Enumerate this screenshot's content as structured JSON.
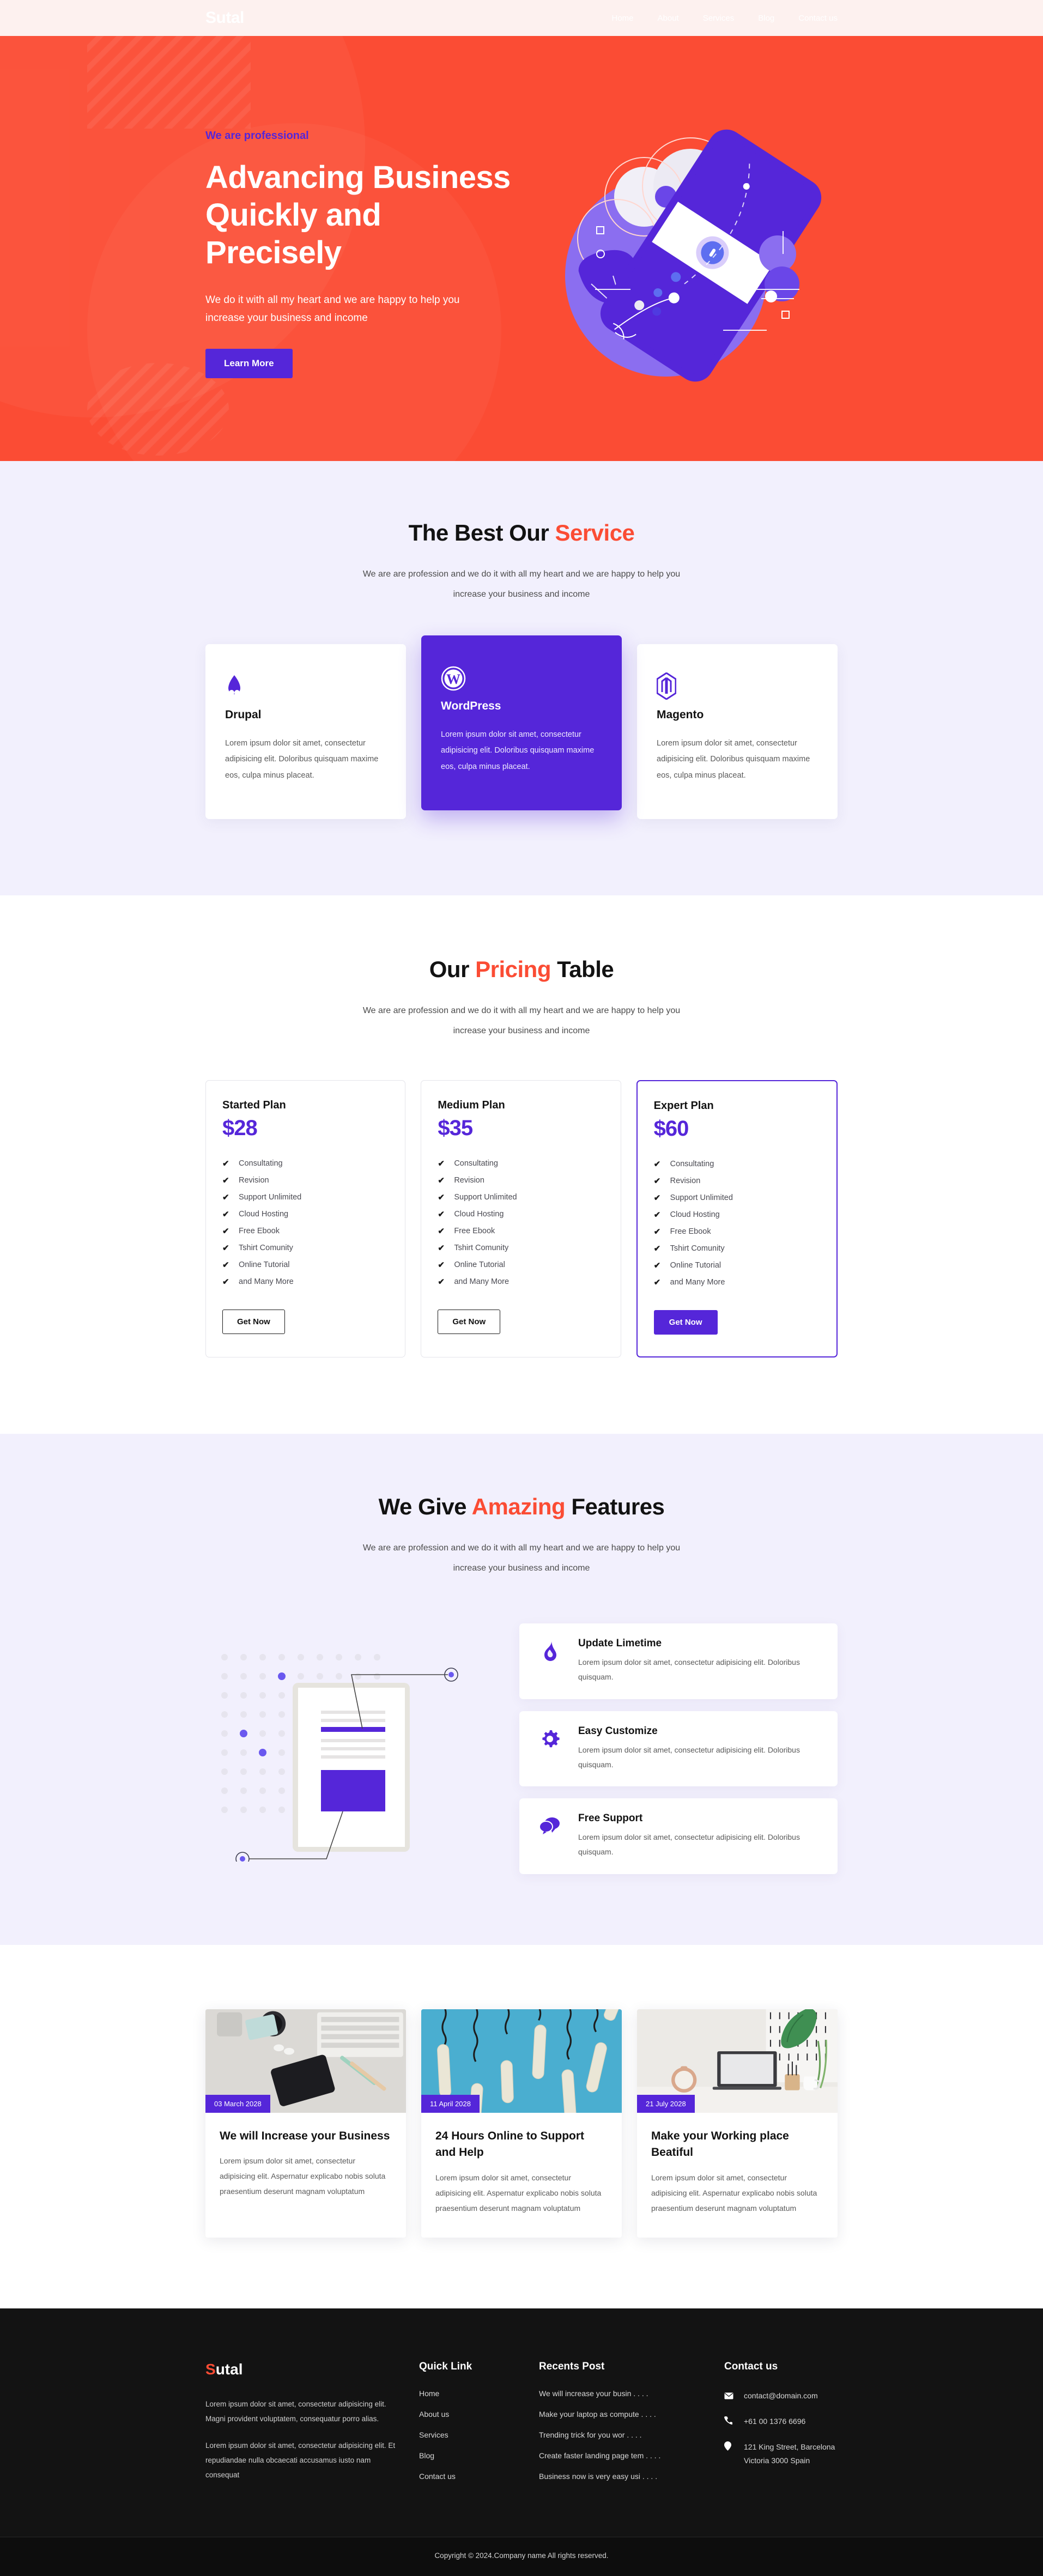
{
  "header": {
    "logo_s": "S",
    "logo_rest": "utal",
    "nav": [
      {
        "label": "Home"
      },
      {
        "label": "About"
      },
      {
        "label": "Services"
      },
      {
        "label": "Blog"
      },
      {
        "label": "Contact us"
      }
    ]
  },
  "hero": {
    "kicker": "We are professional",
    "title": "Advancing Business\nQuickly and Precisely",
    "subtitle": "We do it with all my heart and we are happy to help you increase your business and income",
    "cta": "Learn More",
    "bg_color": "#fb4c34",
    "accent_color": "#5526d9"
  },
  "services": {
    "title_pre": "The Best Our ",
    "title_hl": "Service",
    "subtitle_l1": "We are are profession and we do it with all my heart and we are happy to help you",
    "subtitle_l2": "increase your business and income",
    "cards": [
      {
        "name": "Drupal",
        "icon": "drupal-icon",
        "text": "Lorem ipsum dolor sit amet, consectetur adipisicing elit. Doloribus quisquam maxime eos, culpa minus placeat."
      },
      {
        "name": "WordPress",
        "icon": "wordpress-icon",
        "text": "Lorem ipsum dolor sit amet, consectetur adipisicing elit. Doloribus quisquam maxime eos, culpa minus placeat."
      },
      {
        "name": "Magento",
        "icon": "magento-icon",
        "text": "Lorem ipsum dolor sit amet, consectetur adipisicing elit. Doloribus quisquam maxime eos, culpa minus placeat."
      }
    ]
  },
  "pricing": {
    "title_pre": "Our ",
    "title_hl": "Pricing",
    "title_post": " Table",
    "subtitle_l1": "We are are profession and we do it with all my heart and we are happy to help you",
    "subtitle_l2": "increase your business and income",
    "plans": [
      {
        "name": "Started Plan",
        "price": "$28",
        "features": [
          "Consultating",
          "Revision",
          "Support Unlimited",
          "Cloud Hosting",
          "Free Ebook",
          "Tshirt Comunity",
          "Online Tutorial",
          "and Many More"
        ],
        "cta": "Get Now"
      },
      {
        "name": "Medium Plan",
        "price": "$35",
        "features": [
          "Consultating",
          "Revision",
          "Support Unlimited",
          "Cloud Hosting",
          "Free Ebook",
          "Tshirt Comunity",
          "Online Tutorial",
          "and Many More"
        ],
        "cta": "Get Now"
      },
      {
        "name": "Expert Plan",
        "price": "$60",
        "features": [
          "Consultating",
          "Revision",
          "Support Unlimited",
          "Cloud Hosting",
          "Free Ebook",
          "Tshirt Comunity",
          "Online Tutorial",
          "and Many More"
        ],
        "cta": "Get Now"
      }
    ]
  },
  "features": {
    "title_pre": "We Give ",
    "title_hl": "Amazing",
    "title_post": " Features",
    "subtitle_l1": "We are are profession and we do it with all my heart and we are happy to help you",
    "subtitle_l2": "increase your business and income",
    "items": [
      {
        "title": "Update Limetime",
        "icon": "fire-icon",
        "text": "Lorem ipsum dolor sit amet, consectetur adipisicing elit. Doloribus quisquam."
      },
      {
        "title": "Easy Customize",
        "icon": "gear-icon",
        "text": "Lorem ipsum dolor sit amet, consectetur adipisicing elit. Doloribus quisquam."
      },
      {
        "title": "Free Support",
        "icon": "chat-icon",
        "text": "Lorem ipsum dolor sit amet, consectetur adipisicing elit. Doloribus quisquam."
      }
    ]
  },
  "blog": {
    "posts": [
      {
        "date": "03 March 2028",
        "title": "We will Increase your Business",
        "text": "Lorem ipsum dolor sit amet, consectetur adipisicing elit. Aspernatur explicabo nobis soluta praesentium deserunt magnam voluptatum"
      },
      {
        "date": "11 April 2028",
        "title": "24 Hours Online to Support and Help",
        "text": "Lorem ipsum dolor sit amet, consectetur adipisicing elit. Aspernatur explicabo nobis soluta praesentium deserunt magnam voluptatum"
      },
      {
        "date": "21 July 2028",
        "title": "Make your Working place Beatiful",
        "text": "Lorem ipsum dolor sit amet, consectetur adipisicing elit. Aspernatur explicabo nobis soluta praesentium deserunt magnam voluptatum"
      }
    ]
  },
  "footer": {
    "logo_s": "S",
    "logo_rest": "utal",
    "about_p1": "Lorem ipsum dolor sit amet, consectetur adipisicing elit. Magni provident voluptatem, consequatur porro alias.",
    "about_p2": "Lorem ipsum dolor sit amet, consectetur adipisicing elit. Et repudiandae nulla obcaecati accusamus iusto nam consequat",
    "quick_head": "Quick Link",
    "quick_links": [
      {
        "label": "Home"
      },
      {
        "label": "About us"
      },
      {
        "label": "Services"
      },
      {
        "label": "Blog"
      },
      {
        "label": "Contact us"
      }
    ],
    "recent_head": "Recents Post",
    "recent_posts": [
      {
        "label": "We will increase your busin . . . ."
      },
      {
        "label": "Make your laptop as compute . . . ."
      },
      {
        "label": "Trending trick for you wor . . . ."
      },
      {
        "label": "Create faster landing page tem . . . ."
      },
      {
        "label": "Business now is very easy usi . . . ."
      }
    ],
    "contact_head": "Contact us",
    "contacts": [
      {
        "icon": "envelope-icon",
        "value": "contact@domain.com"
      },
      {
        "icon": "phone-icon",
        "value": "+61 00 1376 6696"
      },
      {
        "icon": "location-pin-icon",
        "value": "121 King Street, Barcelona Victoria 3000 Spain"
      }
    ],
    "copyright": "Copyright © 2024.Company name All rights reserved."
  }
}
